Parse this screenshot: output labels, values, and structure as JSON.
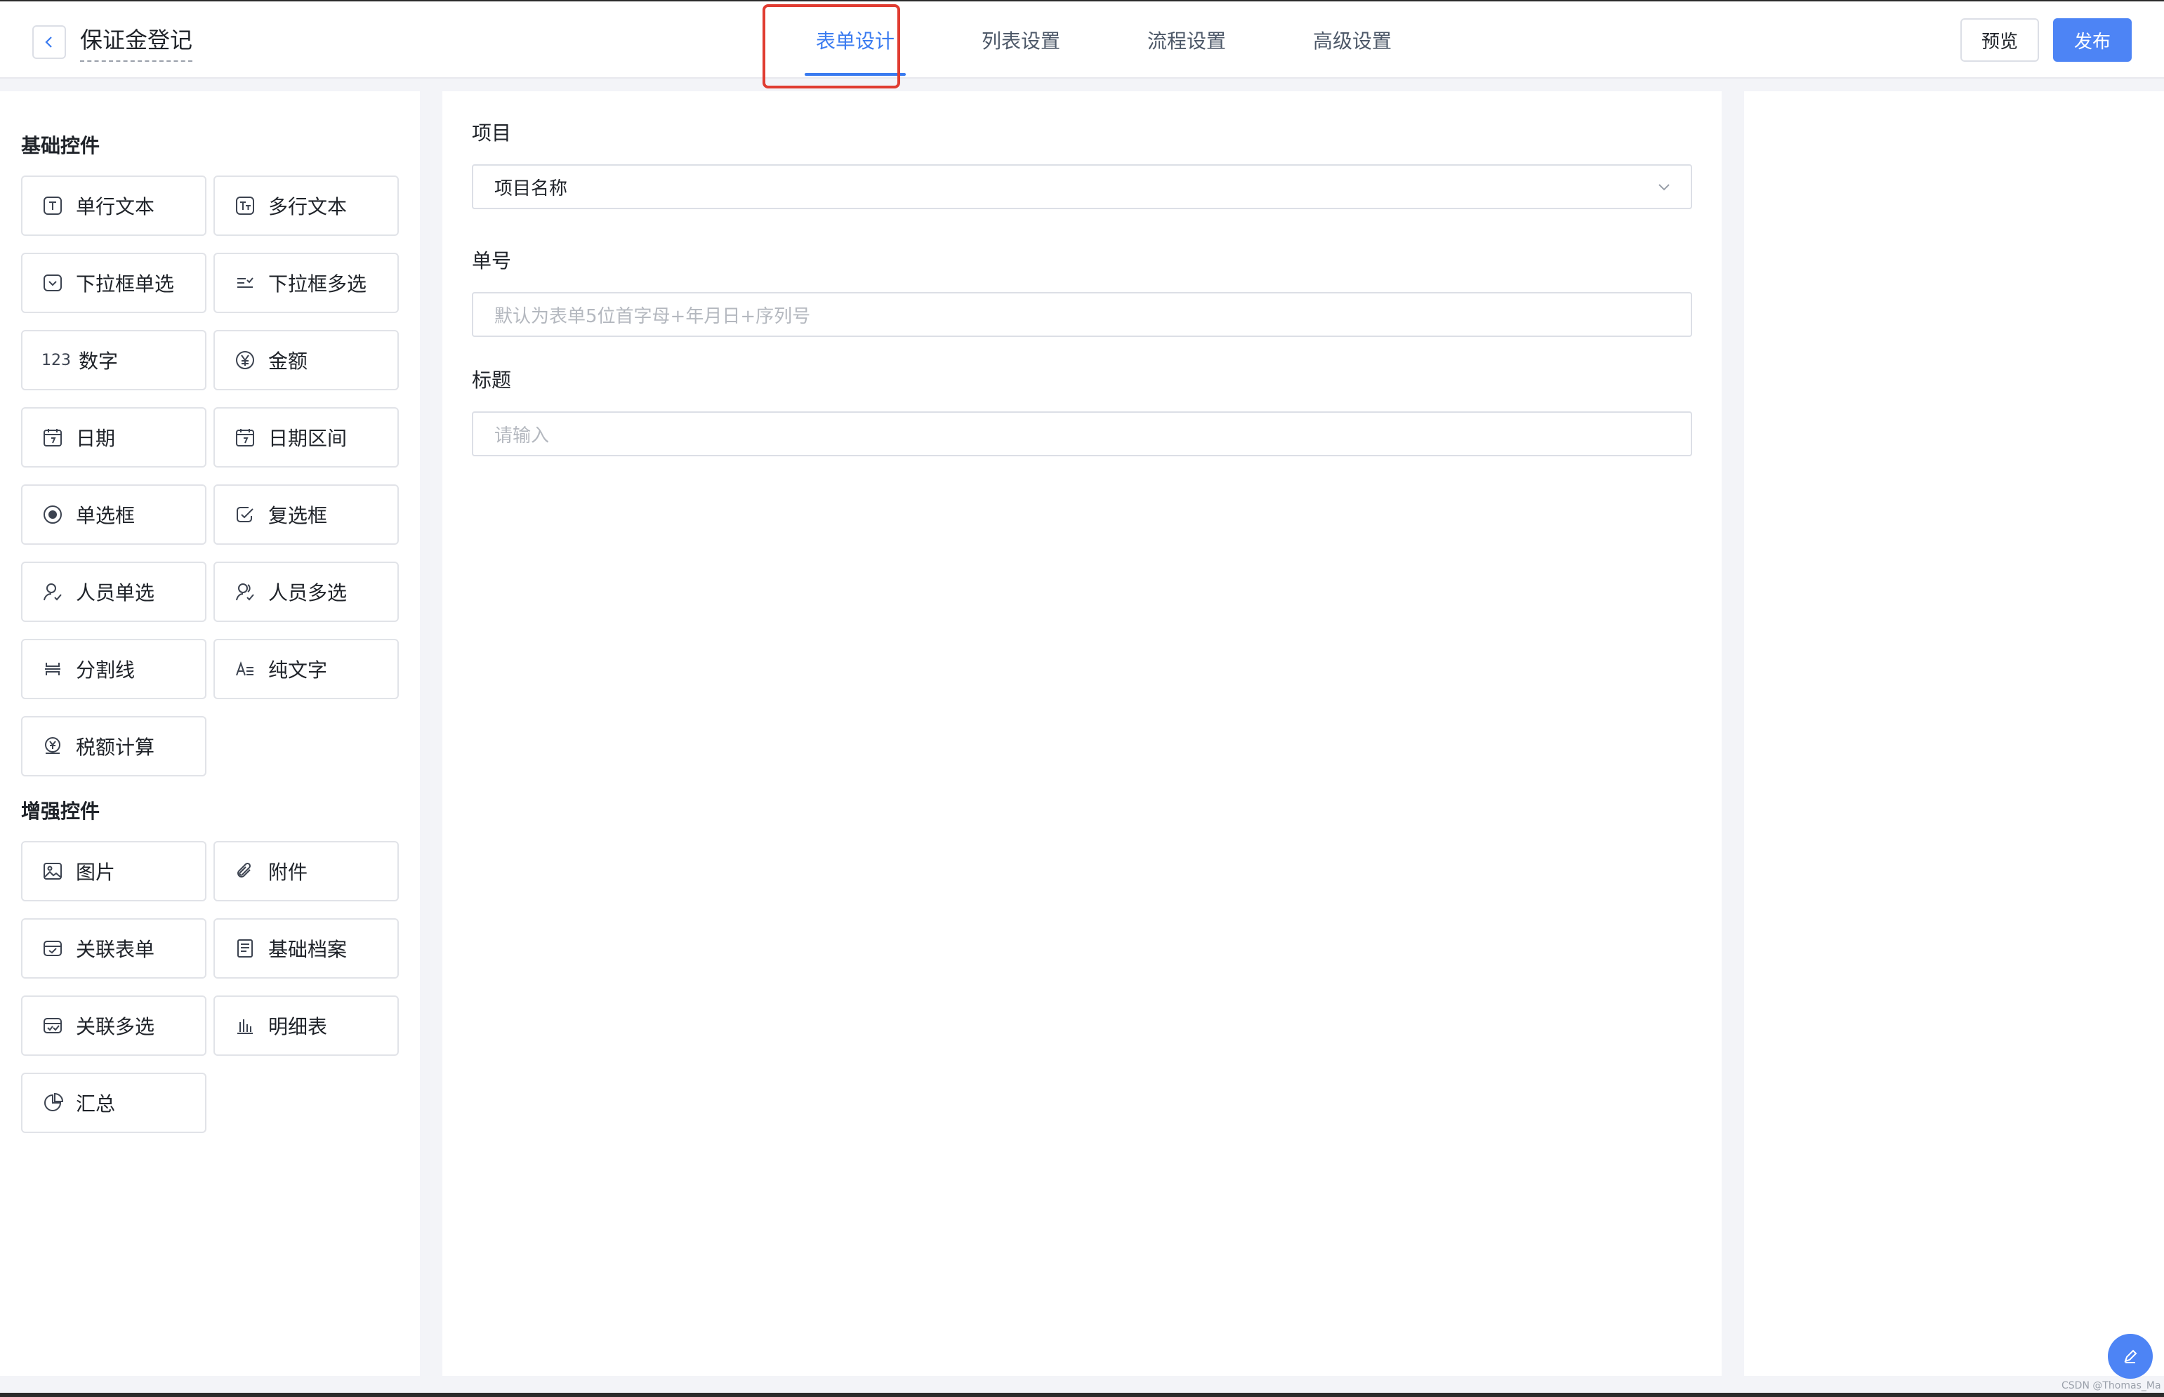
{
  "header": {
    "title": "保证金登记",
    "tabs": [
      {
        "label": "表单设计"
      },
      {
        "label": "列表设置"
      },
      {
        "label": "流程设置"
      },
      {
        "label": "高级设置"
      }
    ],
    "preview_label": "预览",
    "publish_label": "发布",
    "accent_color": "#3a7bf0"
  },
  "sidebar": {
    "basic_title": "基础控件",
    "basic": [
      {
        "label": "单行文本",
        "icon": "text-icon"
      },
      {
        "label": "多行文本",
        "icon": "multiline-text-icon"
      },
      {
        "label": "下拉框单选",
        "icon": "dropdown-icon"
      },
      {
        "label": "下拉框多选",
        "icon": "multi-dropdown-icon"
      },
      {
        "label": "数字",
        "icon": "number-icon",
        "glyph": "123"
      },
      {
        "label": "金额",
        "icon": "yen-icon"
      },
      {
        "label": "日期",
        "icon": "calendar-icon"
      },
      {
        "label": "日期区间",
        "icon": "calendar-range-icon"
      },
      {
        "label": "单选框",
        "icon": "radio-icon"
      },
      {
        "label": "复选框",
        "icon": "checkbox-icon"
      },
      {
        "label": "人员单选",
        "icon": "user-icon"
      },
      {
        "label": "人员多选",
        "icon": "users-icon"
      },
      {
        "label": "分割线",
        "icon": "divider-icon"
      },
      {
        "label": "纯文字",
        "icon": "plain-text-icon"
      },
      {
        "label": "税额计算",
        "icon": "tax-icon"
      }
    ],
    "enhanced_title": "增强控件",
    "enhanced": [
      {
        "label": "图片",
        "icon": "image-icon"
      },
      {
        "label": "附件",
        "icon": "paperclip-icon"
      },
      {
        "label": "关联表单",
        "icon": "linked-form-icon"
      },
      {
        "label": "基础档案",
        "icon": "archive-icon"
      },
      {
        "label": "关联多选",
        "icon": "linked-multi-icon"
      },
      {
        "label": "明细表",
        "icon": "bar-chart-icon"
      },
      {
        "label": "汇总",
        "icon": "pie-icon"
      }
    ]
  },
  "form": {
    "fields": [
      {
        "label": "项目",
        "value": "项目名称",
        "placeholder": "",
        "type": "select"
      },
      {
        "label": "单号",
        "value": "",
        "placeholder": "默认为表单5位首字母+年月日+序列号",
        "type": "input"
      },
      {
        "label": "标题",
        "value": "",
        "placeholder": "请输入",
        "type": "input"
      }
    ]
  },
  "watermark": "CSDN @Thomas_Ma"
}
